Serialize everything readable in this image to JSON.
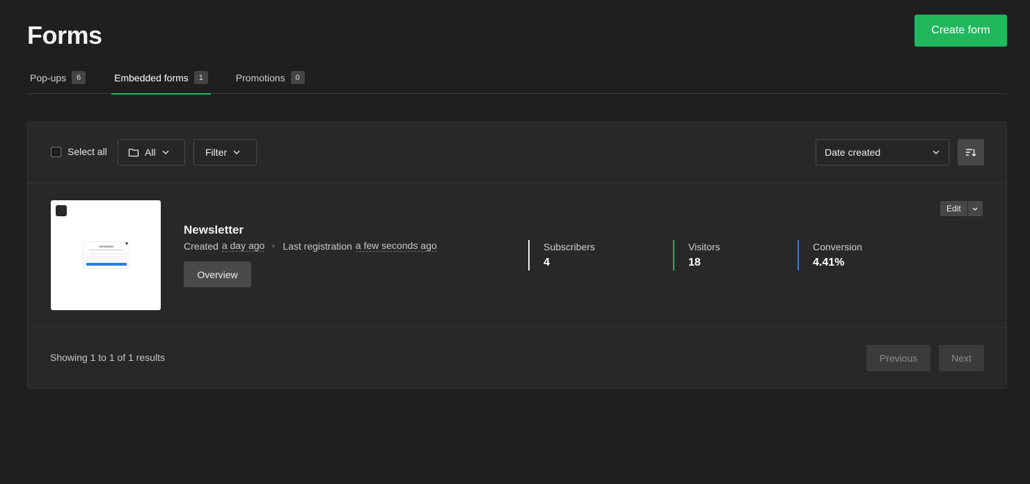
{
  "header": {
    "title": "Forms",
    "create_button": "Create form"
  },
  "tabs": [
    {
      "label": "Pop-ups",
      "count": "6",
      "active": false
    },
    {
      "label": "Embedded forms",
      "count": "1",
      "active": true
    },
    {
      "label": "Promotions",
      "count": "0",
      "active": false
    }
  ],
  "toolbar": {
    "select_all": "Select all",
    "folder_filter": "All",
    "filter": "Filter",
    "sort_by": "Date created"
  },
  "forms": [
    {
      "name": "Newsletter",
      "created_label": "Created",
      "created_value": "a day ago",
      "last_reg_label": "Last registration",
      "last_reg_value": "a few seconds ago",
      "overview_button": "Overview",
      "edit_button": "Edit",
      "stats": [
        {
          "label": "Subscribers",
          "value": "4",
          "color": "#f0f0f0"
        },
        {
          "label": "Visitors",
          "value": "18",
          "color": "#1fb85d"
        },
        {
          "label": "Conversion",
          "value": "4.41%",
          "color": "#3d7be0"
        }
      ],
      "preview": {
        "title": "Newsletter"
      }
    }
  ],
  "pagination": {
    "summary": "Showing 1 to 1 of 1 results",
    "previous": "Previous",
    "next": "Next"
  },
  "colors": {
    "accent": "#1fb85d",
    "background": "#1f1f1f",
    "panel": "#282828"
  }
}
